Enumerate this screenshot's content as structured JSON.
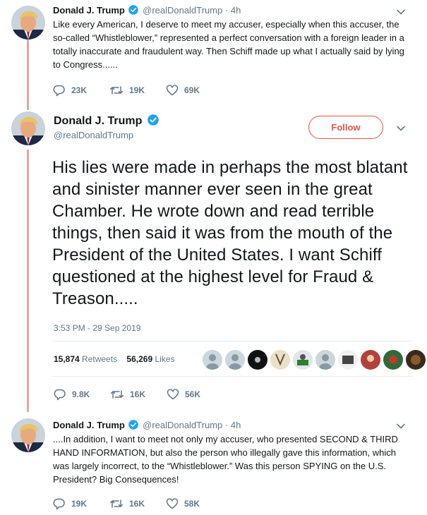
{
  "tweet1": {
    "name": "Donald J. Trump",
    "handle": "@realDonaldTrump",
    "separator": "·",
    "time": "4h",
    "text": "Like every American, I deserve to meet my accuser, especially when this accuser, the so-called “Whistleblower,” represented a perfect conversation with a foreign leader in a totally inaccurate and fraudulent way. Then Schiff made up what I actually said by lying to Congress......",
    "replies": "23K",
    "retweets": "19K",
    "likes": "69K"
  },
  "main_tweet": {
    "name": "Donald J. Trump",
    "handle": "@realDonaldTrump",
    "follow_label": "Follow",
    "text": "His lies were made in perhaps the most blatant and sinister manner ever seen in the great Chamber. He wrote down and read terrible things, then said it was from the mouth of the President of the United States. I want Schiff questioned at the highest level for Fraud & Treason.....",
    "timestamp": "3:53 PM - 29 Sep 2019",
    "retweet_count": "15,874",
    "retweet_label": "Retweets",
    "like_count": "56,269",
    "like_label": "Likes",
    "replies": "9.8K",
    "retweets": "16K",
    "likes": "56K"
  },
  "tweet3": {
    "name": "Donald J. Trump",
    "handle": "@realDonaldTrump",
    "separator": "·",
    "time": "4h",
    "text": "....In addition, I want to meet not only my accuser, who presented SECOND & THIRD HAND INFORMATION, but also the person who illegally gave this information, which was largely incorrect, to the “Whistleblower.” Was this person SPYING on the U.S. President? Big Consequences!",
    "replies": "19K",
    "retweets": "16K",
    "likes": "58K"
  },
  "colors": {
    "accent": "#e8524a",
    "thread_line": "#e1a8a2",
    "muted": "#657786",
    "verified": "#1da1f2"
  }
}
